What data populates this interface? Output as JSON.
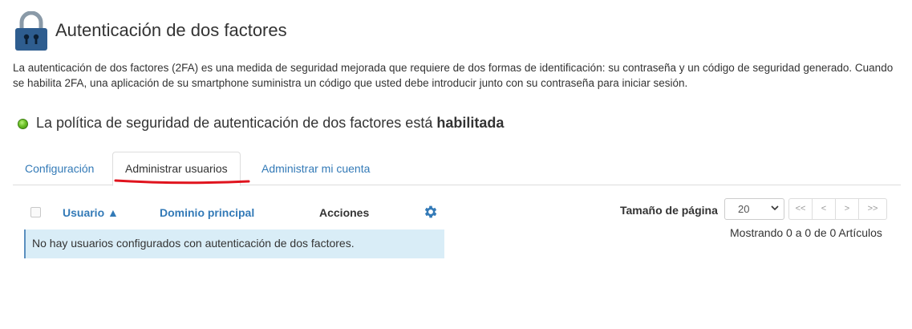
{
  "header": {
    "title": "Autenticación de dos factores",
    "icon": "lock-icon"
  },
  "description": "La autenticación de dos factores (2FA) es una medida de seguridad mejorada que requiere de dos formas de identificación: su contraseña y un código de seguridad generado. Cuando se habilita 2FA, una aplicación de su smartphone suministra un código que usted debe introducir junto con su contraseña para iniciar sesión.",
  "policy": {
    "text": "La política de seguridad de autenticación de dos factores está",
    "status": "habilitada",
    "status_color": "#6cc126"
  },
  "tabs": [
    {
      "label": "Configuración",
      "active": false
    },
    {
      "label": "Administrar usuarios",
      "active": true
    },
    {
      "label": "Administrar mi cuenta",
      "active": false
    }
  ],
  "table": {
    "columns": {
      "user": "Usuario ▲",
      "domain": "Dominio principal",
      "actions": "Acciones"
    },
    "empty_message": "No hay usuarios configurados con autenticación de dos factores."
  },
  "pager": {
    "page_size_label": "Tamaño de página",
    "page_size_value": "20",
    "buttons": [
      "<<",
      "<",
      ">",
      ">>"
    ],
    "showing": "Mostrando 0 a 0 de 0 Artículos"
  },
  "colors": {
    "link": "#337ab7",
    "accent_underline": "#e0141e",
    "info_row": "#d9edf7",
    "lock": "#2e5d8f"
  }
}
